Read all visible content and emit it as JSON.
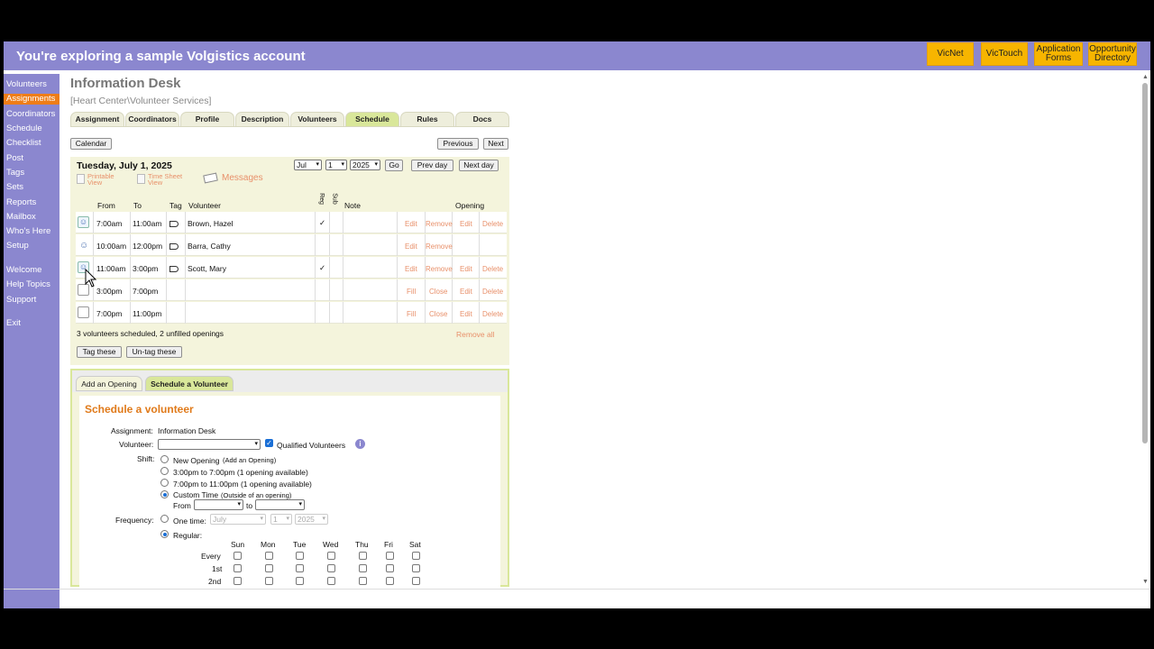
{
  "banner": {
    "title": "You're exploring a sample Volgistics account"
  },
  "top_buttons": [
    "VicNet",
    "VicTouch",
    "Application Forms",
    "Opportunity Directory"
  ],
  "nav": [
    "Volunteers",
    "Assignments",
    "Coordinators",
    "Schedule",
    "Checklist",
    "Post",
    "Tags",
    "Sets",
    "Reports",
    "Mailbox",
    "Who's Here",
    "Setup",
    "Welcome",
    "Help Topics",
    "Support",
    "Exit"
  ],
  "active_nav": "Assignments",
  "page": {
    "title": "Information Desk",
    "breadcrumb": "[Heart Center\\Volunteer Services]"
  },
  "tabs": [
    "Assignment",
    "Coordinators",
    "Profile",
    "Description",
    "Volunteers",
    "Schedule",
    "Rules",
    "Docs"
  ],
  "active_tab": "Schedule",
  "toolbar": {
    "calendar": "Calendar",
    "previous": "Previous",
    "next": "Next"
  },
  "date_nav": {
    "month": "Jul",
    "day": "1",
    "year": "2025",
    "go": "Go",
    "prev_day": "Prev day",
    "next_day": "Next day"
  },
  "schedule": {
    "date_title": "Tuesday, July 1, 2025",
    "printable_view": "Printable View",
    "time_sheet_view": "Time Sheet View",
    "messages": "Messages",
    "headers": {
      "from": "From",
      "to": "To",
      "tag": "Tag",
      "volunteer": "Volunteer",
      "reg": "Reg",
      "sub": "Sub",
      "note": "Note",
      "opening": "Opening"
    },
    "rows": [
      {
        "from": "7:00am",
        "to": "11:00am",
        "volunteer": "Brown, Hazel",
        "reg": "✓",
        "a1": "Edit",
        "a2": "Remove",
        "a3": "Edit",
        "a4": "Delete"
      },
      {
        "from": "10:00am",
        "to": "12:00pm",
        "volunteer": "Barra, Cathy",
        "reg": "",
        "a1": "Edit",
        "a2": "Remove",
        "a3": "",
        "a4": ""
      },
      {
        "from": "11:00am",
        "to": "3:00pm",
        "volunteer": "Scott, Mary",
        "reg": "✓",
        "a1": "Edit",
        "a2": "Remove",
        "a3": "Edit",
        "a4": "Delete"
      },
      {
        "from": "3:00pm",
        "to": "7:00pm",
        "volunteer": "",
        "reg": "",
        "a1": "Fill",
        "a2": "Close",
        "a3": "Edit",
        "a4": "Delete"
      },
      {
        "from": "7:00pm",
        "to": "11:00pm",
        "volunteer": "",
        "reg": "",
        "a1": "Fill",
        "a2": "Close",
        "a3": "Edit",
        "a4": "Delete"
      }
    ],
    "summary": "3 volunteers scheduled, 2 unfilled openings",
    "remove_all": "Remove all",
    "tag_these": "Tag these",
    "untag_these": "Un-tag these"
  },
  "form_tabs": [
    "Add an Opening",
    "Schedule a Volunteer"
  ],
  "active_form_tab": "Schedule a Volunteer",
  "form": {
    "heading": "Schedule a volunteer",
    "assignment_label": "Assignment:",
    "assignment_value": "Information Desk",
    "volunteer_label": "Volunteer:",
    "qualified_label": "Qualified Volunteers",
    "shift_label": "Shift:",
    "shift_options": [
      "New Opening",
      "3:00pm to 7:00pm (1 opening available)",
      "7:00pm to 11:00pm (1 opening available)",
      "Custom Time"
    ],
    "new_opening_note": "(Add an Opening)",
    "custom_time_note": "(Outside of an opening)",
    "from_label": "From",
    "to_label": "to",
    "frequency_label": "Frequency:",
    "one_time": "One time:",
    "one_time_month": "July",
    "one_time_day": "1",
    "one_time_year": "2025",
    "regular": "Regular:",
    "days": [
      "Sun",
      "Mon",
      "Tue",
      "Wed",
      "Thu",
      "Fri",
      "Sat"
    ],
    "week_rows": [
      "Every",
      "1st",
      "2nd"
    ]
  },
  "colors": {
    "banner": "#8b87cf",
    "accent": "#ee7d18",
    "button": "#f7b500",
    "panel": "#f4f4dc",
    "active_tab": "#d9e79a"
  }
}
